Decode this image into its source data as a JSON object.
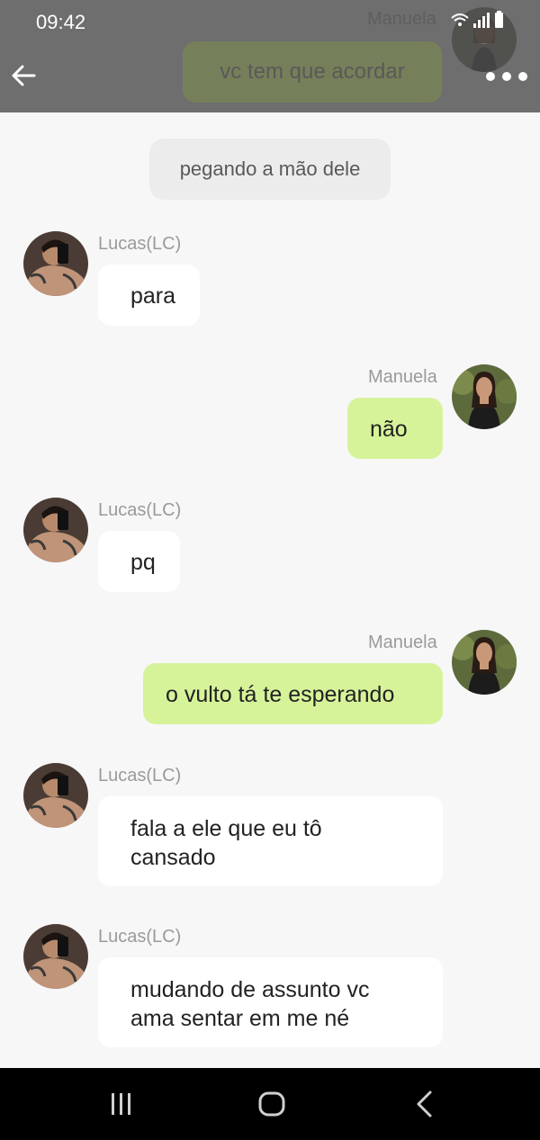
{
  "status_bar": {
    "time": "09:42"
  },
  "header": {
    "ghost_sender": "Manuela",
    "ghost_message": "vc tem que acordar",
    "back_icon": "arrow-left-icon",
    "more_icon": "more-horizontal-icon"
  },
  "chat": {
    "action_message": "pegando a mão dele",
    "messages": [
      {
        "sender": "Lucas(LC)",
        "text": "para",
        "direction": "incoming"
      },
      {
        "sender": "Manuela",
        "text": "não",
        "direction": "outgoing"
      },
      {
        "sender": "Lucas(LC)",
        "text": "pq",
        "direction": "incoming"
      },
      {
        "sender": "Manuela",
        "text": "o vulto tá te esperando",
        "direction": "outgoing"
      },
      {
        "sender": "Lucas(LC)",
        "text_lines": [
          "fala a ele que eu tô",
          "cansado"
        ],
        "direction": "incoming"
      },
      {
        "sender": "Lucas(LC)",
        "text_lines": [
          "mudando de assunto vc",
          "ama sentar em me né"
        ],
        "direction": "incoming"
      }
    ]
  },
  "navbar": {
    "recent_icon": "recent-apps-icon",
    "home_icon": "home-icon",
    "back_icon": "nav-back-icon"
  },
  "colors": {
    "header_bg": "#6e6e6e",
    "chat_bg": "#f7f7f7",
    "incoming_bubble": "#ffffff",
    "outgoing_bubble": "#d7f39a",
    "action_bubble": "#ececec",
    "sender_text": "#9a9a9a",
    "navbar_bg": "#000000"
  }
}
